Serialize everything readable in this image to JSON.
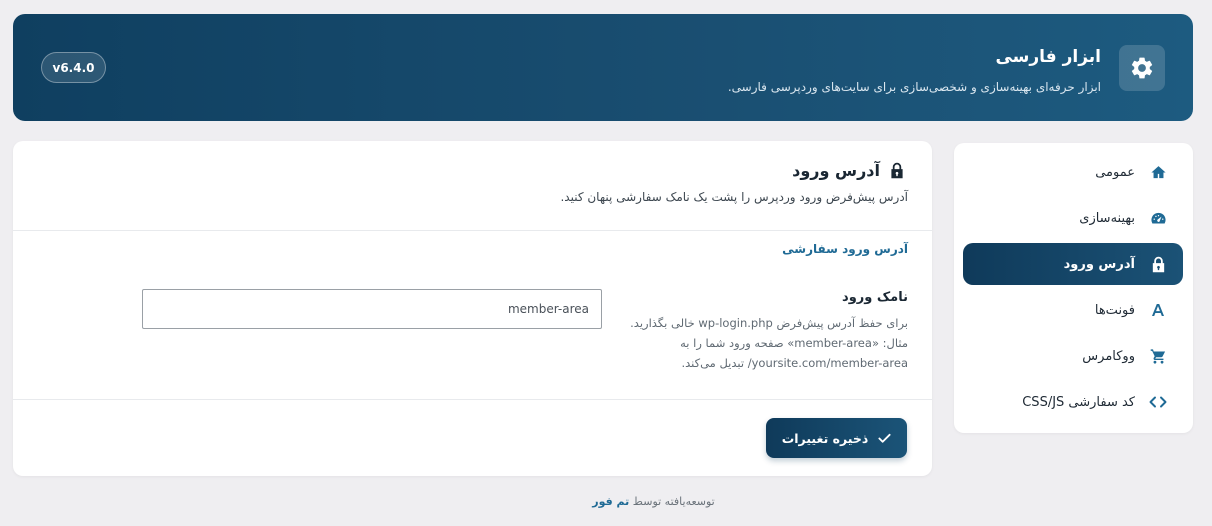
{
  "header": {
    "title": "ابزار فارسی",
    "subtitle": "ابزار حرفه‌ای بهینه‌سازی و شخصی‌سازی برای سایت‌های وردپرسی فارسی.",
    "version": "v6.4.0",
    "icon": "gear-icon"
  },
  "sidebar": {
    "items": [
      {
        "label": "عمومی",
        "icon": "home-icon"
      },
      {
        "label": "بهینه‌سازی",
        "icon": "speedometer-icon"
      },
      {
        "label": "آدرس ورود",
        "icon": "lock-icon",
        "active": true
      },
      {
        "label": "فونت‌ها",
        "icon": "font-icon"
      },
      {
        "label": "ووکامرس",
        "icon": "cart-icon"
      },
      {
        "label": "کد سفارشی CSS/JS",
        "icon": "code-icon"
      }
    ]
  },
  "main": {
    "title": "آدرس ورود",
    "description": "آدرس پیش‌فرض ورود وردپرس را پشت یک نامک سفارشی پنهان کنید.",
    "subtitle": "آدرس ورود سفارشی",
    "field": {
      "label": "نامک ورود",
      "help": [
        "برای حفظ آدرس پیش‌فرض wp-login.php خالی بگذارید.",
        "مثال: «member-area» صفحه ورود شما را به",
        "yoursite.com/member-area/ تبدیل می‌کند."
      ],
      "value": "member-area"
    },
    "save_label": "ذخیره تغییرات"
  },
  "footer": {
    "prefix": "توسعه‌یافته توسط",
    "brand": "تم فور"
  },
  "colors": {
    "accent": "#1b5276",
    "link": "#1f6a95",
    "background": "#efeef1"
  }
}
